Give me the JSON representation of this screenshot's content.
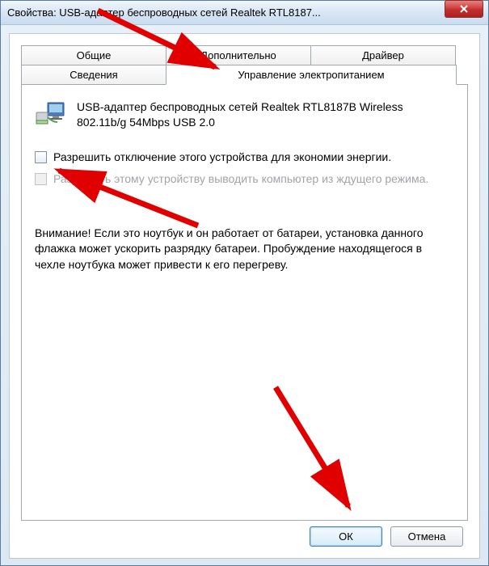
{
  "window": {
    "title": "Свойства: USB-адаптер беспроводных сетей Realtek RTL8187..."
  },
  "tabs": {
    "general": "Общие",
    "advanced": "Дополнительно",
    "driver": "Драйвер",
    "details": "Сведения",
    "power": "Управление электропитанием"
  },
  "device": {
    "name": "USB-адаптер беспроводных сетей Realtek RTL8187B Wireless 802.11b/g 54Mbps USB 2.0"
  },
  "checkboxes": {
    "allow_off": "Разрешить отключение этого устройства для экономии энергии.",
    "allow_wake": "Разрешить этому устройству выводить компьютер из ждущего режима."
  },
  "warning": "Внимание! Если это ноутбук и он работает от батареи, установка данного флажка может ускорить разрядку батареи. Пробуждение находящегося в чехле ноутбука может привести к его перегреву.",
  "buttons": {
    "ok": "ОК",
    "cancel": "Отмена"
  }
}
